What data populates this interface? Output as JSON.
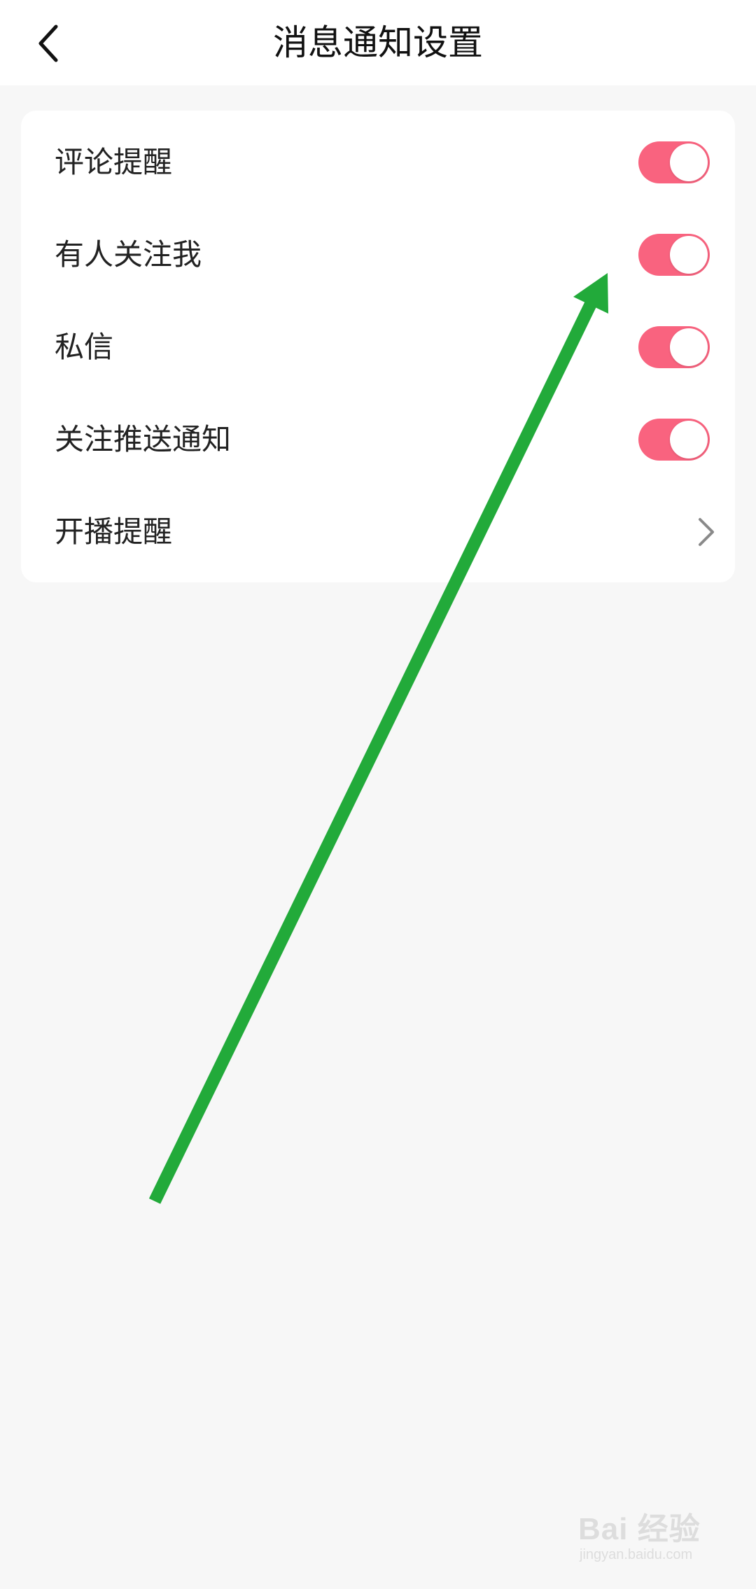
{
  "header": {
    "title": "消息通知设置",
    "back_icon": "chevron-left-icon"
  },
  "settings": {
    "items": [
      {
        "label": "评论提醒",
        "type": "toggle",
        "enabled": true
      },
      {
        "label": "有人关注我",
        "type": "toggle",
        "enabled": true
      },
      {
        "label": "私信",
        "type": "toggle",
        "enabled": true
      },
      {
        "label": "关注推送通知",
        "type": "toggle",
        "enabled": true
      },
      {
        "label": "开播提醒",
        "type": "link",
        "icon": "chevron-right-icon"
      }
    ]
  },
  "colors": {
    "toggle_on": "#f9637f",
    "annotation_arrow": "#22aa3a",
    "background": "#f7f7f7"
  },
  "watermark": {
    "main": "Bai 经验",
    "sub": "jingyan.baidu.com"
  }
}
